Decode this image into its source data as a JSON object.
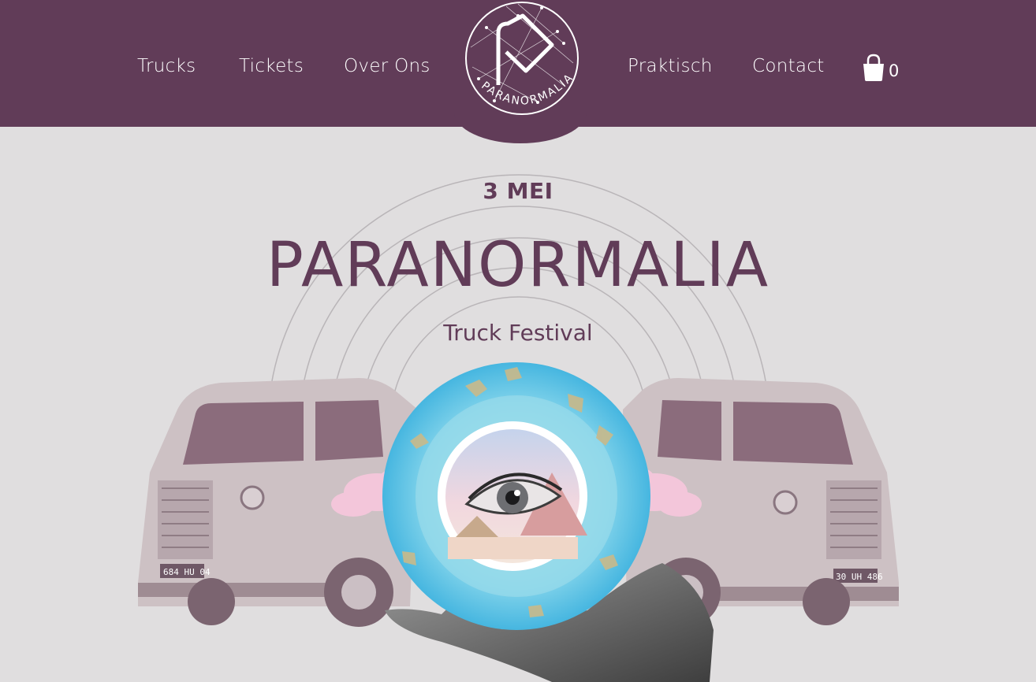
{
  "header": {
    "nav_left": [
      "Trucks",
      "Tickets",
      "Over Ons"
    ],
    "nav_right": [
      "Praktisch",
      "Contact"
    ],
    "logo_text": "PARANORMALIA",
    "cart_count": "0",
    "background": "#613c58"
  },
  "hero": {
    "date": "3 MEI",
    "title": "PARANORMALIA",
    "subtitle": "Truck Festival",
    "plate_left": "684 HU 04",
    "plate_right": "30 UH 486"
  },
  "colors": {
    "accent": "#613c58",
    "background": "#e0dedf",
    "orb": "#5ec6e6"
  }
}
